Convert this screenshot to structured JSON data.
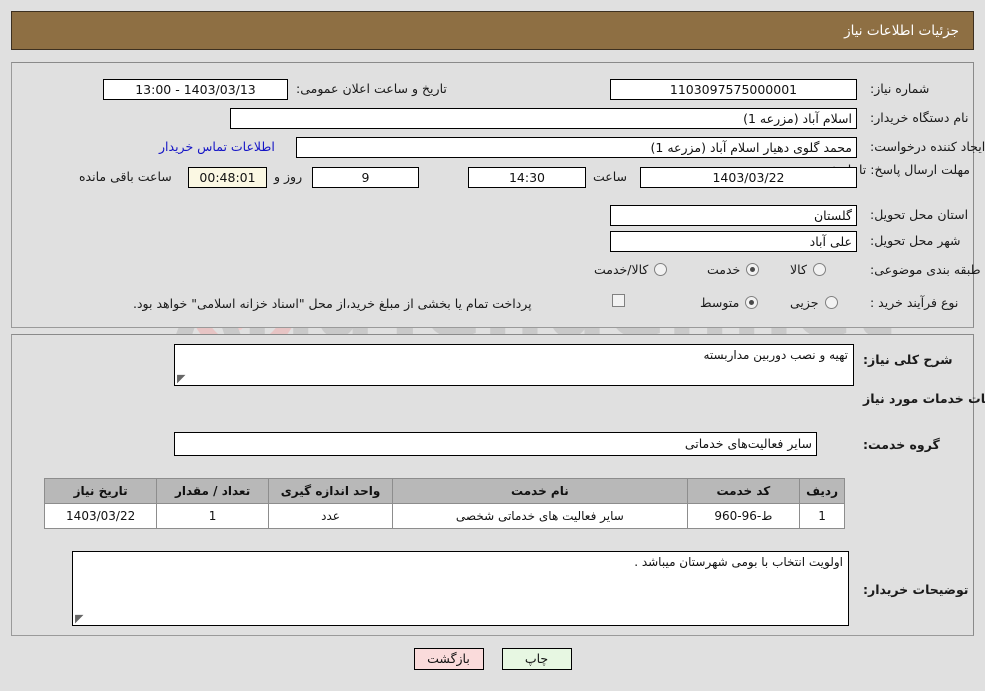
{
  "header": {
    "title": "جزئیات اطلاعات نیاز"
  },
  "colors": {
    "header_bg": "#8e6f43",
    "page_bg": "#e0e0e0",
    "link": "#1515c6",
    "timer_bg": "#fbf8e3",
    "back_btn_bg": "#fadbdb",
    "print_btn_bg": "#e7f7e2",
    "table_header_bg": "#b8b8b8"
  },
  "need_info": {
    "need_number_label": "شماره نیاز:",
    "need_number_value": "1103097575000001",
    "public_announce_label": "تاریخ و ساعت اعلان عمومی:",
    "public_announce_value": "1403/03/13 - 13:00",
    "buyer_org_label": "نام دستگاه خریدار:",
    "buyer_org_value": "اسلام آباد (مزرعه 1)",
    "creator_label": "ایجاد کننده درخواست:",
    "creator_value": "محمد گلوی دهیار اسلام آباد (مزرعه 1)",
    "contact_link": "اطلاعات تماس خریدار",
    "deadline_label": "مهلت ارسال پاسخ: تا تاریخ:",
    "deadline_date": "1403/03/22",
    "deadline_hour_label": "ساعت",
    "deadline_hour": "14:30",
    "remaining_days": "9",
    "days_and_label": "روز و",
    "remaining_time": "00:48:01",
    "remaining_hours_label": "ساعت باقی مانده",
    "province_label": "استان محل تحویل:",
    "province_value": "گلستان",
    "city_label": "شهر محل تحویل:",
    "city_value": "علی آباد",
    "category_label": "طبقه بندی موضوعی:",
    "category_options": [
      {
        "label": "کالا",
        "selected": false
      },
      {
        "label": "خدمت",
        "selected": true
      },
      {
        "label": "کالا/خدمت",
        "selected": false
      }
    ],
    "process_label": "نوع فرآیند خرید :",
    "process_options": [
      {
        "label": "جزیی",
        "selected": false
      },
      {
        "label": "متوسط",
        "selected": true
      }
    ],
    "treasury_checkbox_checked": false,
    "treasury_note": "پرداخت تمام یا بخشی از مبلغ خرید،از محل \"اسناد خزانه اسلامی\" خواهد بود."
  },
  "details": {
    "need_desc_label": "شرح کلی نیاز:",
    "need_desc_value": "تهیه و نصب دوربین مداربسته",
    "services_section_title": "اطلاعات خدمات مورد نیاز",
    "service_group_label": "گروه خدمت:",
    "service_group_value": "سایر فعالیت‌های خدماتی",
    "buyer_notes_label": "توضیحات خریدار:",
    "buyer_notes_value": "اولویت انتخاب با بومی شهرستان میباشد ."
  },
  "table": {
    "headers": [
      "ردیف",
      "کد خدمت",
      "نام خدمت",
      "واحد اندازه گیری",
      "تعداد / مقدار",
      "تاریخ نیاز"
    ],
    "rows": [
      {
        "row": "1",
        "code": "ط-96-960",
        "name": "سایر فعالیت های خدماتی شخصی",
        "unit": "عدد",
        "quantity": "1",
        "date": "1403/03/22"
      }
    ]
  },
  "footer": {
    "back_label": "بازگشت",
    "print_label": "چاپ"
  },
  "watermark": {
    "text": "AriaTender.net"
  }
}
